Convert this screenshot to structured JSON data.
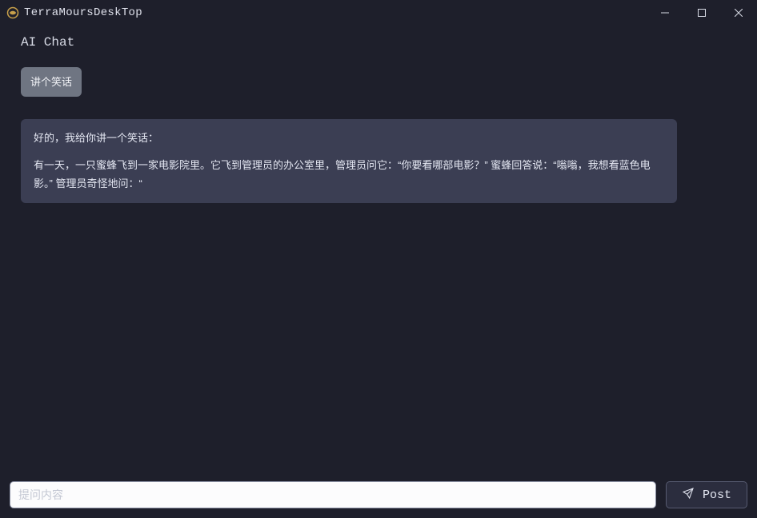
{
  "window": {
    "title": "TerraMoursDeskTop"
  },
  "header": {
    "title": "AI Chat"
  },
  "messages": {
    "user1": "讲个笑话",
    "ai1_intro": "好的，我给你讲一个笑话：",
    "ai1_body": "有一天，一只蜜蜂飞到一家电影院里。它飞到管理员的办公室里，管理员问它：“你要看哪部电影？” 蜜蜂回答说：“嗡嗡，我想看蓝色电影。” 管理员奇怪地问：“"
  },
  "compose": {
    "placeholder": "提问内容",
    "button": "Post"
  }
}
